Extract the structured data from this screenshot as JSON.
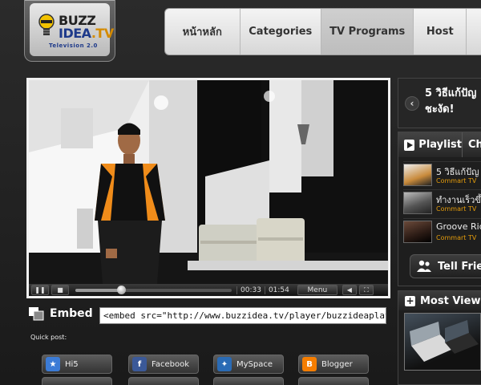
{
  "brand": {
    "name_line1": "BUZZ",
    "name_line2": "IDEA",
    "name_suffix": ".TV",
    "tagline": "Television 2.0"
  },
  "nav": {
    "items": [
      {
        "label": "หน้าหลัก",
        "active": false
      },
      {
        "label": "Categories",
        "active": false
      },
      {
        "label": "TV Programs",
        "active": true
      },
      {
        "label": "Host",
        "active": false
      }
    ]
  },
  "player": {
    "current_time": "00:33",
    "duration": "01:54",
    "progress": 0.29,
    "menu_label": "Menu"
  },
  "embed": {
    "label": "Embed",
    "code": "<embed src=\"http://www.buzzidea.tv/player/buzzideaplayer.swf\""
  },
  "quick_post": {
    "label": "Quick post:",
    "services": [
      {
        "label": "Hi5",
        "icon": "hi5-icon",
        "color": "#3b7bd6"
      },
      {
        "label": "Facebook",
        "icon": "facebook-icon",
        "color": "#3b5998"
      },
      {
        "label": "MySpace",
        "icon": "myspace-icon",
        "color": "#2a6bb5"
      },
      {
        "label": "Blogger",
        "icon": "blogger-icon",
        "color": "#f57d00"
      }
    ]
  },
  "now_playing": {
    "title_line1": "5 วิธีแก้ปัญ",
    "title_line2": "ชะงัด!"
  },
  "playlist": {
    "tab_playlist": "Playlist",
    "tab_channel": "Ch",
    "items": [
      {
        "title": "5 วิธีแก้ปัญ",
        "channel": "Commart TV"
      },
      {
        "title": "ทำงานเร็วขึ้",
        "channel": "Commart TV"
      },
      {
        "title": "Groove Rid",
        "channel": "Commart TV"
      }
    ],
    "tell_friend": "Tell Frie"
  },
  "most_view": {
    "label": "Most View"
  },
  "colors": {
    "accent_orange": "#e39b0b",
    "nav_bg": "#e6e6e6",
    "page_bg": "#1b1b1b"
  }
}
